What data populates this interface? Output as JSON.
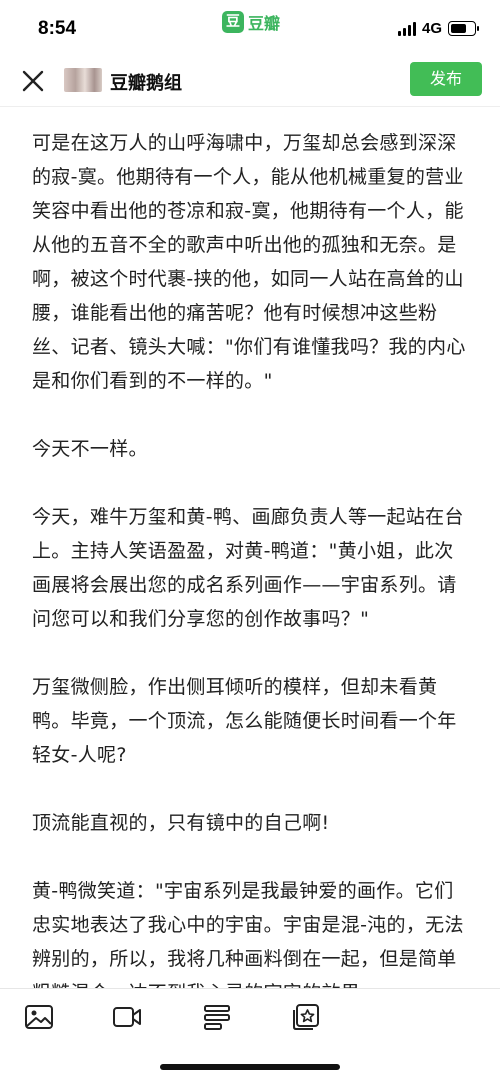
{
  "status": {
    "time": "8:54",
    "app_logo_char": "豆",
    "app_name": "豆瓣",
    "network": "4G"
  },
  "header": {
    "group_name": "豆瓣鹅组",
    "publish_label": "发布"
  },
  "content": {
    "paragraphs": [
      "可是在这万人的山呼海啸中，万玺却总会感到深深的寂-寞。他期待有一个人，能从他机械重复的营业笑容中看出他的苍凉和寂-寞，他期待有一个人，能从他的五音不全的歌声中听出他的孤独和无奈。是啊，被这个时代裹-挟的他，如同一人站在高耸的山腰，谁能看出他的痛苦呢？他有时候想冲这些粉丝、记者、镜头大喊：\"你们有谁懂我吗？我的内心是和你们看到的不一样的。\"",
      "今天不一样。",
      "今天，难牛万玺和黄-鸭、画廊负责人等一起站在台上。主持人笑语盈盈，对黄-鸭道：\"黄小姐，此次画展将会展出您的成名系列画作——宇宙系列。请问您可以和我们分享您的创作故事吗？\"",
      "万玺微侧脸，作出侧耳倾听的模样，但却未看黄鸭。毕竟，一个顶流，怎么能随便长时间看一个年轻女-人呢?",
      "顶流能直视的，只有镜中的自己啊!",
      "黄-鸭微笑道：\"宇宙系列是我最钟爱的画作。它们忠实地表达了我心中的宇宙。宇宙是混-沌的，无法辨别的，所以，我将几种画料倒在一起，但是简单粗糙混合，达不到我心灵的宇宙的效果"
    ]
  },
  "toolbar": {
    "icons": [
      "image-icon",
      "video-icon",
      "text-format-icon",
      "sticker-icon"
    ]
  },
  "colors": {
    "brand_green": "#42bd56",
    "text": "#222222"
  }
}
